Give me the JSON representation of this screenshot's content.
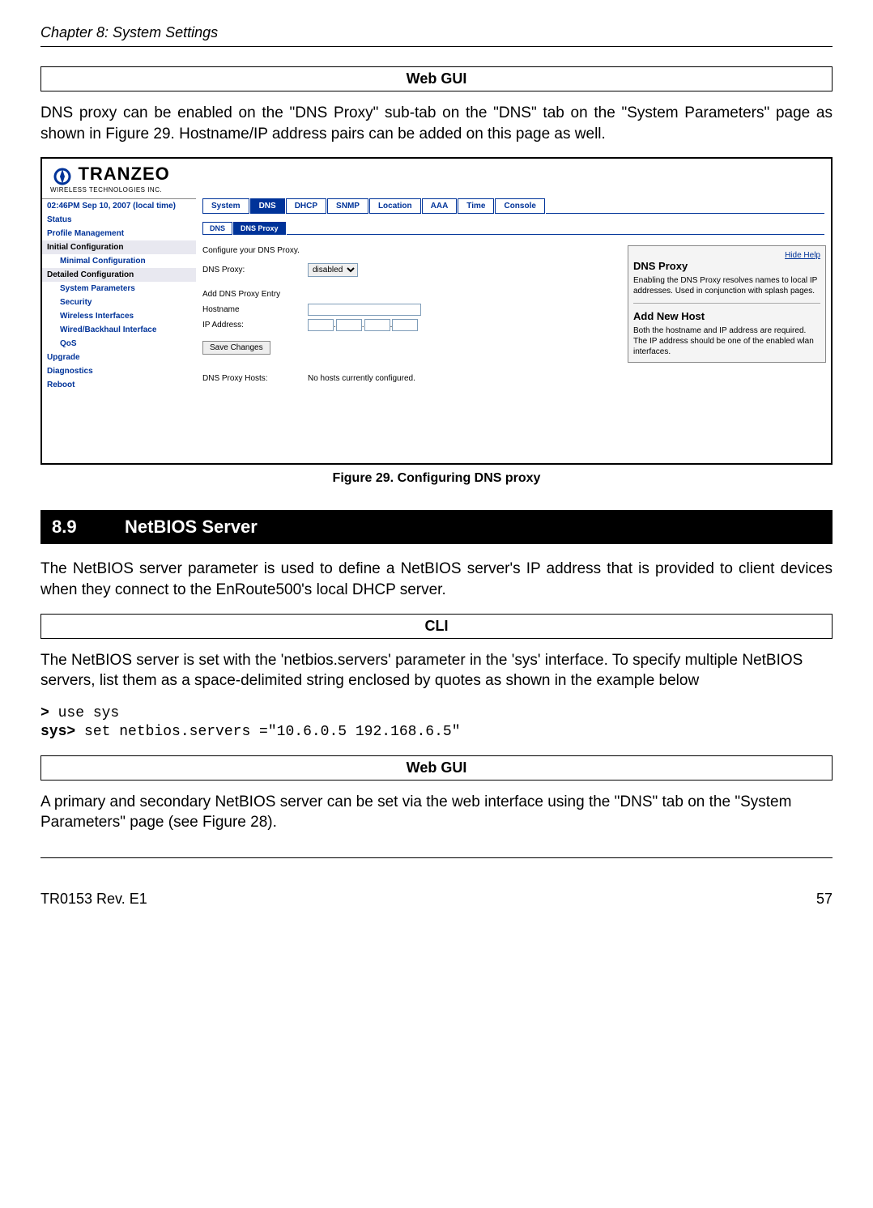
{
  "chapter": "Chapter 8: System Settings",
  "box1": "Web GUI",
  "para1": "DNS proxy can be enabled on the \"DNS Proxy\" sub-tab on the \"DNS\" tab on the \"System Parameters\" page as shown in Figure 29. Hostname/IP address pairs can be added on this page as well.",
  "figure": {
    "logo_main": "TRANZEO",
    "logo_sub": "WIRELESS TECHNOLOGIES INC.",
    "sidebar": {
      "time": "02:46PM Sep 10, 2007 (local time)",
      "status": "Status",
      "profile": "Profile Management",
      "initial": "Initial Configuration",
      "minimal": "Minimal Configuration",
      "detailed": "Detailed Configuration",
      "sysparams": "System Parameters",
      "security": "Security",
      "wireless": "Wireless Interfaces",
      "wired": "Wired/Backhaul Interface",
      "qos": "QoS",
      "upgrade": "Upgrade",
      "diag": "Diagnostics",
      "reboot": "Reboot"
    },
    "tabs": {
      "system": "System",
      "dns": "DNS",
      "dhcp": "DHCP",
      "snmp": "SNMP",
      "location": "Location",
      "aaa": "AAA",
      "time": "Time",
      "console": "Console"
    },
    "subtabs": {
      "dns": "DNS",
      "dnsproxy": "DNS Proxy"
    },
    "config_text": "Configure your DNS Proxy.",
    "dns_proxy_label": "DNS Proxy:",
    "dns_proxy_value": "disabled",
    "add_entry": "Add DNS Proxy Entry",
    "hostname_label": "Hostname",
    "ip_label": "IP Address:",
    "save_btn": "Save Changes",
    "hosts_label": "DNS Proxy Hosts:",
    "hosts_value": "No hosts currently configured.",
    "help": {
      "hide": "Hide Help",
      "title1": "DNS Proxy",
      "body1": "Enabling the DNS Proxy resolves names to local IP addresses. Used in conjunction with splash pages.",
      "title2": "Add New Host",
      "body2": "Both the hostname and IP address are required. The IP address should be one of the enabled wlan interfaces."
    }
  },
  "figure_caption": "Figure 29. Configuring DNS proxy",
  "section": {
    "num": "8.9",
    "title": "NetBIOS Server"
  },
  "para2": "The NetBIOS server parameter is used to define a NetBIOS server's IP address that is provided to client devices when they connect to the EnRoute500's local DHCP server.",
  "box2": "CLI",
  "para3": "The NetBIOS server is set with the 'netbios.servers' parameter in the 'sys' interface. To specify multiple NetBIOS servers, list them as a space-delimited string enclosed by quotes as shown in the example below",
  "cli": {
    "p1": ">",
    "c1": " use sys",
    "p2": "sys>",
    "c2": " set netbios.servers =\"10.6.0.5 192.168.6.5\""
  },
  "box3": "Web GUI",
  "para4": "A primary and secondary NetBIOS server can be set via the web interface using the \"DNS\" tab on the \"System Parameters\" page (see Figure 28).",
  "footer": {
    "left": "TR0153 Rev. E1",
    "right": "57"
  }
}
